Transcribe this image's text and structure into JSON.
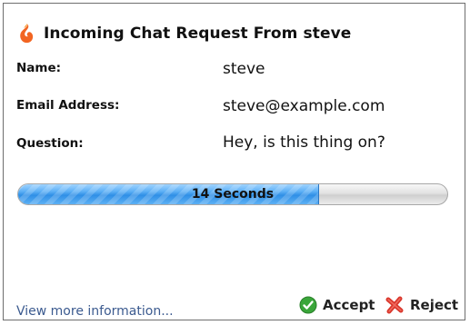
{
  "dialog": {
    "title": "Incoming Chat Request From steve",
    "logo_icon": "flame-logo-icon",
    "accent_color": "#f26522"
  },
  "fields": {
    "name_label": "Name:",
    "name_value": "steve",
    "email_label": "Email Address:",
    "email_value": "steve@example.com",
    "question_label": "Question:",
    "question_value": "Hey, is this thing on?"
  },
  "progress": {
    "label": "14 Seconds",
    "fraction": 0.7,
    "fill_color": "#2f8fe6"
  },
  "footer": {
    "more_link": "View more information...",
    "accept_label": "Accept",
    "accept_icon": "check-circle-icon",
    "accept_color": "#3aa63a",
    "reject_label": "Reject",
    "reject_icon": "red-x-icon",
    "reject_color": "#d9362b"
  }
}
